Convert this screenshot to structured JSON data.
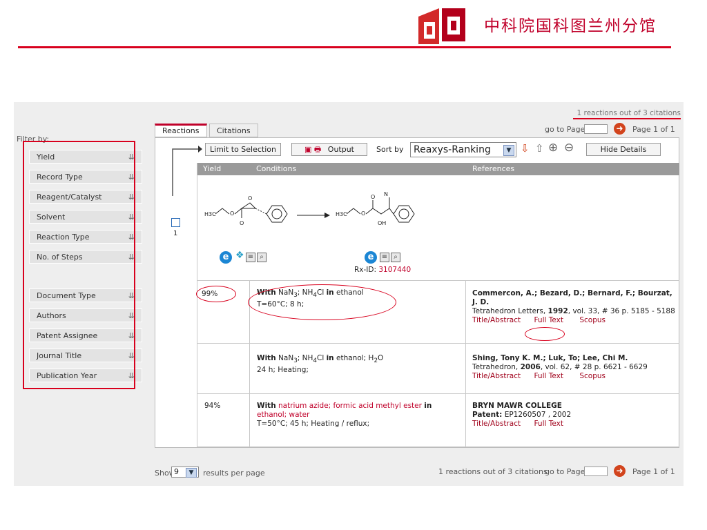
{
  "header": {
    "org_name": "中科院国科图兰州分馆"
  },
  "summary_top": "1 reactions out of 3 citations",
  "filter": {
    "label": "Filter by:",
    "items": [
      "Yield",
      "Record Type",
      "Reagent/Catalyst",
      "Solvent",
      "Reaction Type",
      "No. of Steps"
    ],
    "items2": [
      "Document Type",
      "Authors",
      "Patent Assignee",
      "Journal Title",
      "Publication Year"
    ],
    "arrow": "⇊"
  },
  "tabs": {
    "reactions": "Reactions",
    "citations": "Citations"
  },
  "pager_top": {
    "goto_label": "go to Page",
    "page_info": "Page 1 of 1"
  },
  "toolbar": {
    "limit": "Limit to Selection",
    "output": "Output",
    "sort_label": "Sort by",
    "sort_value": "Reaxys-Ranking",
    "hide": "Hide Details"
  },
  "columns": {
    "yield": "Yield",
    "conditions": "Conditions",
    "references": "References"
  },
  "reaction": {
    "index": "1",
    "rxid_label": "Rx-ID:",
    "rxid": "3107440",
    "reactant_labels": {
      "methyl": "H3C",
      "ester_o": "O",
      "carbonyl_o": "O",
      "epoxide_o": "O"
    },
    "product_labels": {
      "methyl": "H3C",
      "ester_o": "O",
      "carbonyl_o": "O",
      "azide": "N",
      "hydroxyl": "OH"
    }
  },
  "rows": [
    {
      "yield": "99%",
      "with_label": "With",
      "cond_pre": "NaN",
      "cond_sub1": "3",
      "cond_mid": "; NH",
      "cond_sub2": "4",
      "cond_post": "Cl",
      "in_label": "in",
      "solvent": "ethanol",
      "details": "T=60°C; 8 h;",
      "authors": "Commercon, A.; Bezard, D.; Bernard, F.; Bourzat, J. D.",
      "journal": "Tetrahedron Letters,",
      "year": "1992",
      "vol": ", vol. 33, # 36 p. 5185 - 5188",
      "links": [
        "Title/Abstract",
        "Full Text",
        "Scopus"
      ]
    },
    {
      "with_label": "With",
      "cond_pre": "NaN",
      "cond_sub1": "3",
      "cond_mid": "; NH",
      "cond_sub2": "4",
      "cond_post": "Cl",
      "in_label": "in",
      "solvent_a": "ethanol; H",
      "solvent_sub": "2",
      "solvent_b": "O",
      "details": "24 h; Heating;",
      "authors": "Shing, Tony K. M.; Luk, To; Lee, Chi M.",
      "journal": "Tetrahedron,",
      "year": "2006",
      "vol": ", vol. 62, # 28 p. 6621 - 6629",
      "links": [
        "Title/Abstract",
        "Full Text",
        "Scopus"
      ]
    },
    {
      "yield": "94%",
      "with_label": "With",
      "reagents": "natrium azide; formic acid methyl ester",
      "in_label": "in",
      "solvent_red": "ethanol; water",
      "details": "T=50°C; 45 h; Heating / reflux;",
      "assignee": "BRYN MAWR COLLEGE",
      "patent_label": "Patent:",
      "patent": "EP1260507 , 2002",
      "links": [
        "Title/Abstract",
        "Full Text"
      ]
    }
  ],
  "footer": {
    "show_label": "Show",
    "per_page_value": "9",
    "results_label": "results per page",
    "summary": "1 reactions out of 3 citations",
    "goto_label": "go to Page",
    "page_info": "Page 1 of 1"
  },
  "colors": {
    "accent_red": "#d8001d",
    "header_gray": "#9a9a9a"
  }
}
